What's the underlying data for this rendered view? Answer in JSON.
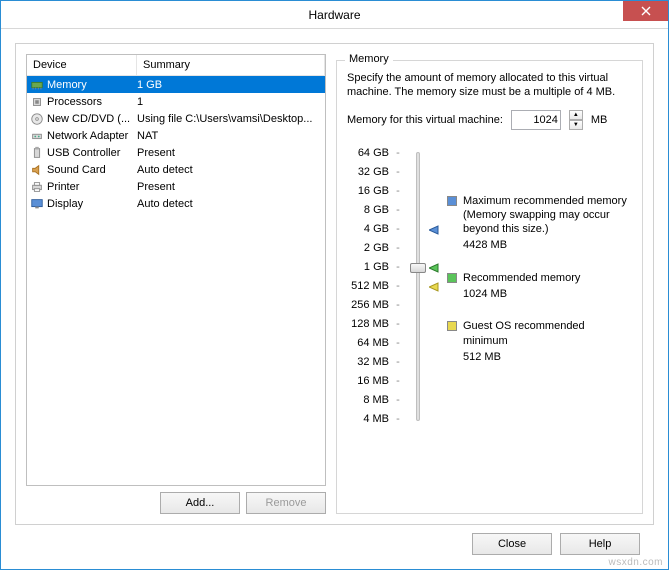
{
  "window": {
    "title": "Hardware"
  },
  "columns": {
    "device": "Device",
    "summary": "Summary"
  },
  "devices": [
    {
      "name": "Memory",
      "summary": "1 GB",
      "icon": "memory",
      "selected": true
    },
    {
      "name": "Processors",
      "summary": "1",
      "icon": "cpu"
    },
    {
      "name": "New CD/DVD (...",
      "summary": "Using file C:\\Users\\vamsi\\Desktop...",
      "icon": "disc"
    },
    {
      "name": "Network Adapter",
      "summary": "NAT",
      "icon": "network"
    },
    {
      "name": "USB Controller",
      "summary": "Present",
      "icon": "usb"
    },
    {
      "name": "Sound Card",
      "summary": "Auto detect",
      "icon": "sound"
    },
    {
      "name": "Printer",
      "summary": "Present",
      "icon": "printer"
    },
    {
      "name": "Display",
      "summary": "Auto detect",
      "icon": "display"
    }
  ],
  "buttons": {
    "add": "Add...",
    "remove": "Remove",
    "close": "Close",
    "help": "Help"
  },
  "memory": {
    "group_title": "Memory",
    "description": "Specify the amount of memory allocated to this virtual machine. The memory size must be a multiple of 4 MB.",
    "field_label": "Memory for this virtual machine:",
    "value": "1024",
    "unit": "MB",
    "ticks": [
      "64 GB",
      "32 GB",
      "16 GB",
      "8 GB",
      "4 GB",
      "2 GB",
      "1 GB",
      "512 MB",
      "256 MB",
      "128 MB",
      "64 MB",
      "32 MB",
      "16 MB",
      "8 MB",
      "4 MB"
    ],
    "markers": {
      "max": {
        "tick": "4 GB",
        "color": "blue"
      },
      "rec": {
        "tick": "1 GB",
        "color": "green"
      },
      "min": {
        "tick": "512 MB",
        "color": "yellow"
      }
    },
    "thumb_tick": "1 GB",
    "legend": {
      "max": {
        "title": "Maximum recommended memory",
        "sub": "(Memory swapping may occur beyond this size.)",
        "value": "4428 MB"
      },
      "rec": {
        "title": "Recommended memory",
        "value": "1024 MB"
      },
      "min": {
        "title": "Guest OS recommended minimum",
        "value": "512 MB"
      }
    }
  },
  "watermark": "wsxdn.com"
}
